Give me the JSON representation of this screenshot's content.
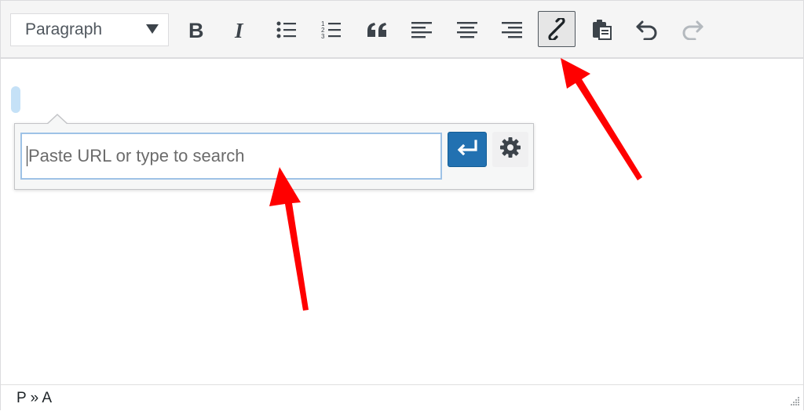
{
  "toolbar": {
    "format_select": {
      "value": "Paragraph"
    },
    "buttons": [
      {
        "name": "bold",
        "icon": "bold-icon"
      },
      {
        "name": "italic",
        "icon": "italic-icon"
      },
      {
        "name": "bulleted-list",
        "icon": "bulleted-list-icon"
      },
      {
        "name": "numbered-list",
        "icon": "numbered-list-icon"
      },
      {
        "name": "blockquote",
        "icon": "blockquote-icon"
      },
      {
        "name": "align-left",
        "icon": "align-left-icon"
      },
      {
        "name": "align-center",
        "icon": "align-center-icon"
      },
      {
        "name": "align-right",
        "icon": "align-right-icon"
      },
      {
        "name": "insert-link",
        "icon": "link-icon",
        "active": true
      },
      {
        "name": "paste-as-text",
        "icon": "clipboard-icon"
      },
      {
        "name": "undo",
        "icon": "undo-icon"
      },
      {
        "name": "redo",
        "icon": "redo-icon",
        "disabled": true
      }
    ]
  },
  "link_popup": {
    "url_input": {
      "value": "",
      "placeholder": "Paste URL or type to search"
    },
    "apply_icon": "enter-icon",
    "settings_icon": "gear-icon"
  },
  "statusbar": {
    "path": "P » A"
  },
  "colors": {
    "accent": "#2271b1",
    "arrow": "#ff0000",
    "input_border": "#9ec2e6"
  }
}
